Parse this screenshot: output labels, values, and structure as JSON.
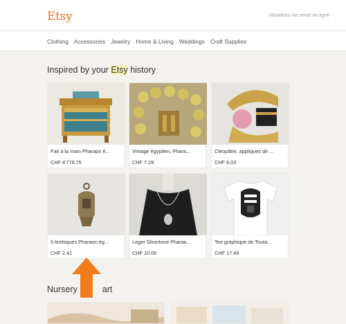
{
  "header": {
    "logo": "Etsy",
    "view_online": "Visualisez cet email en ligne"
  },
  "nav": {
    "items": [
      "Clothing",
      "Accessories",
      "Jewelry",
      "Home & Living",
      "Weddings",
      "Craft Supplies"
    ]
  },
  "section1": {
    "title_before": "Inspired by your ",
    "title_highlight": "Etsy",
    "title_after": " history"
  },
  "products": [
    {
      "title": "Fait à la main Pharaon é...",
      "price": "CHF 4'776.75"
    },
    {
      "title": "Vintage égyptien, Phara...",
      "price": "CHF 7.29"
    },
    {
      "title": "Cléopâtre, appliques de ...",
      "price": "CHF 8.03"
    },
    {
      "title": "5 breloques Pharaon ég...",
      "price": "CHF 2.41"
    },
    {
      "title": "Leger Silvertone Pharao...",
      "price": "CHF 10.06"
    },
    {
      "title": "Tee graphique de Touta...",
      "price": "CHF 17.49"
    }
  ],
  "section2": {
    "title_start": "Nursery",
    "title_end": "art"
  },
  "overlay": {
    "arrow_color": "#f07c1e"
  }
}
